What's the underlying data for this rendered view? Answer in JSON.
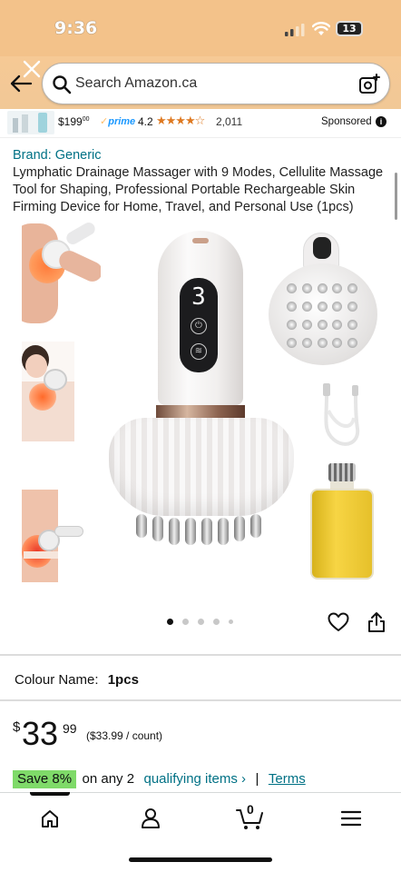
{
  "status": {
    "time": "9:36",
    "battery": "13"
  },
  "search": {
    "placeholder": "Search Amazon.ca"
  },
  "sponsored_strip": {
    "price": "$199",
    "price_cents": "00",
    "prime": "prime",
    "rating": "4.2",
    "stars": 4.2,
    "review_count": "2,011",
    "label": "Sponsored"
  },
  "product": {
    "brand": "Brand: Generic",
    "title": "Lymphatic Drainage Massager with 9 Modes, Cellulite Massage Tool for Shaping, Professional Portable Rechargeable Skin Firming Device for Home, Travel, and Personal Use (1pcs)",
    "device_display_digit": "3",
    "gallery_dots": {
      "count": 5,
      "active_index": 0
    },
    "colour_label": "Colour Name:",
    "colour_value": "1pcs",
    "price_symbol": "$",
    "price_whole": "33",
    "price_cents": "99",
    "unit_price": "($33.99 / count)",
    "save_badge": "Save 8%",
    "promo_text": "on any 2",
    "qualifying_link": "qualifying items",
    "separator": "|",
    "terms_link": "Terms"
  },
  "tabbar": {
    "cart_count": "0",
    "items": [
      "home-icon",
      "account-icon",
      "cart-icon",
      "menu-icon"
    ]
  },
  "colors": {
    "header": "#f3c28a",
    "link": "#007185",
    "save_badge": "#7fda69",
    "star": "#de7921"
  }
}
